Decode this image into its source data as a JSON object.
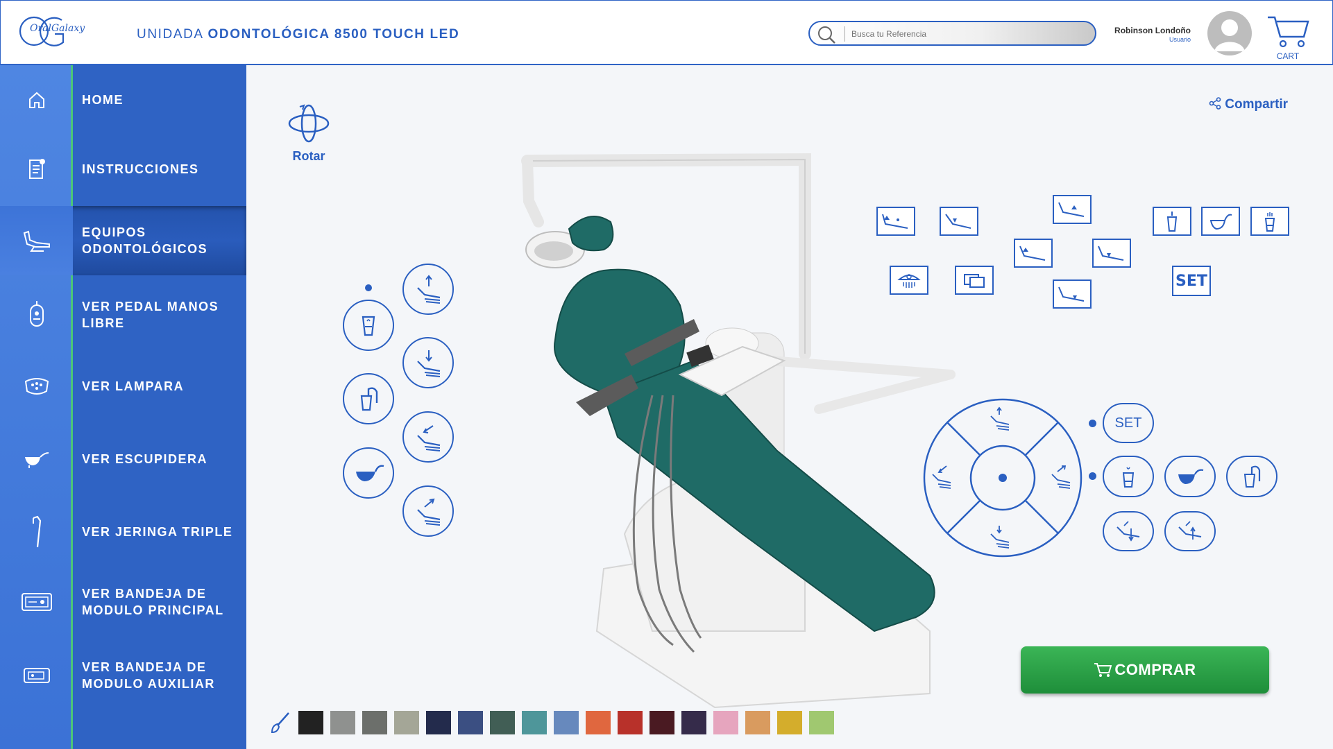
{
  "header": {
    "logo_text": "OralGalaxy",
    "title_prefix": "UNIDADA ",
    "title_bold": "ODONTOLÓGICA 8500 TOUCH LED",
    "search_placeholder": "Busca tu Referencia",
    "user_name": "Robinson Londoño",
    "user_role": "Usuario",
    "cart_label": "CART"
  },
  "sidebar": {
    "items": [
      {
        "label": "HOME",
        "icon": "home-icon"
      },
      {
        "label": "INSTRUCCIONES",
        "icon": "document-icon"
      },
      {
        "label": "EQUIPOS ODONTOLÓGICOS",
        "icon": "dental-chair-icon",
        "active": true
      },
      {
        "label": "VER PEDAL MANOS LIBRE",
        "icon": "pedal-icon"
      },
      {
        "label": "VER LAMPARA",
        "icon": "lamp-icon"
      },
      {
        "label": "VER ESCUPIDERA",
        "icon": "spittoon-icon"
      },
      {
        "label": "VER JERINGA TRIPLE",
        "icon": "syringe-icon"
      },
      {
        "label": "VER BANDEJA DE MODULO PRINCIPAL",
        "icon": "main-tray-icon"
      },
      {
        "label": "VER BANDEJA DE MODULO AUXILIAR",
        "icon": "aux-tray-icon"
      }
    ]
  },
  "viewer": {
    "rotate_label": "Rotar",
    "share_label": "Compartir",
    "set_label": "SET",
    "buy_label": "COMPRAR",
    "brand_color": "#2a5fc1",
    "upholstery_color": "#1f6b66"
  },
  "colors": [
    "#222222",
    "#8f918f",
    "#6c6f6b",
    "#a4a697",
    "#232b4c",
    "#3b4f82",
    "#415e55",
    "#4e969a",
    "#6789bd",
    "#e0673f",
    "#b8312a",
    "#4a1a22",
    "#352b4a",
    "#e6a5be",
    "#d99b5f",
    "#d4ad2c",
    "#a0c870"
  ]
}
